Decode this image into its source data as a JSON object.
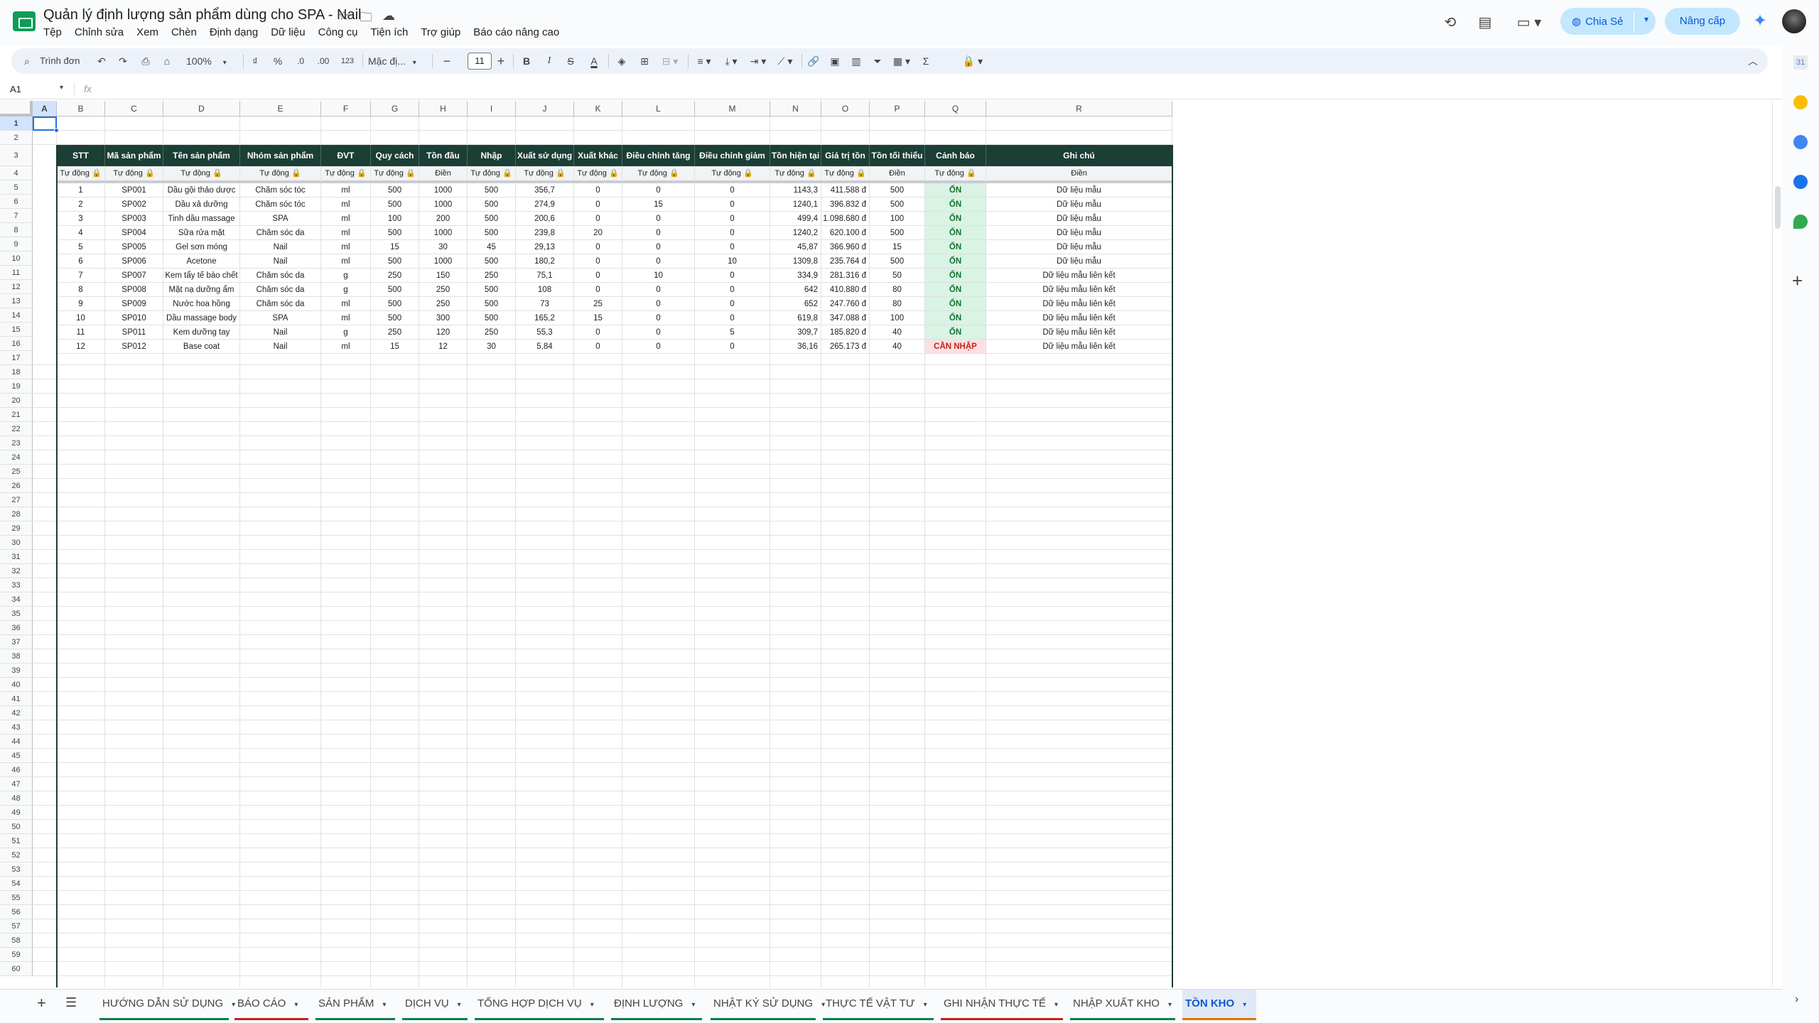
{
  "app": {
    "title": "Quản lý định lượng sản phẩm dùng cho SPA - Nail",
    "menu": [
      "Tệp",
      "Chỉnh sửa",
      "Xem",
      "Chèn",
      "Định dạng",
      "Dữ liệu",
      "Công cụ",
      "Tiện ích",
      "Trợ giúp",
      "Báo cáo nâng cao"
    ],
    "share_label": "Chia Sẻ",
    "upgrade_label": "Nâng cấp"
  },
  "toolbar": {
    "search_label": "Trình đơn",
    "zoom": "100%",
    "currency": "₫",
    "percent": "%",
    "dec_minus": ".0",
    "dec_plus": ".00",
    "num_format": "123",
    "font": "Mặc đị...",
    "font_size": "11",
    "bold": "B",
    "italic": "I",
    "strike": "S",
    "text_color": "A",
    "sum": "Σ"
  },
  "formula_bar": {
    "name_box": "A1",
    "fx": "fx"
  },
  "columns": [
    "A",
    "B",
    "C",
    "D",
    "E",
    "F",
    "G",
    "H",
    "I",
    "J",
    "K",
    "L",
    "M",
    "N",
    "O",
    "P",
    "Q",
    "R"
  ],
  "row_count": 60,
  "table": {
    "headers": [
      "STT",
      "Mã sản phẩm",
      "Tên sản phẩm",
      "Nhóm sản phẩm",
      "ĐVT",
      "Quy cách",
      "Tồn đầu",
      "Nhập",
      "Xuất sử dụng",
      "Xuất khác",
      "Điều chỉnh tăng",
      "Điều chỉnh giảm",
      "Tồn hiện tại",
      "Giá trị tồn",
      "Tồn tối thiểu",
      "Cảnh báo",
      "Ghi chú"
    ],
    "subheaders": [
      "Tự động 🔒",
      "Tự động 🔒",
      "Tự động 🔒",
      "Tự động 🔒",
      "Tự động 🔒",
      "Tự động 🔒",
      "Điền",
      "Tự động 🔒",
      "Tự động 🔒",
      "Tự động 🔒",
      "Tự động 🔒",
      "Tự động 🔒",
      "Tự động 🔒",
      "Tự động 🔒",
      "Điền",
      "Tự động 🔒",
      "Điền"
    ],
    "rows": [
      [
        "1",
        "SP001",
        "Dầu gội thảo dược",
        "Chăm sóc tóc",
        "ml",
        "500",
        "1000",
        "500",
        "356,7",
        "0",
        "0",
        "0",
        "1143,3",
        "411.588 đ",
        "500",
        "ỔN",
        "Dữ liệu mẫu"
      ],
      [
        "2",
        "SP002",
        "Dầu xả dưỡng",
        "Chăm sóc tóc",
        "ml",
        "500",
        "1000",
        "500",
        "274,9",
        "0",
        "15",
        "0",
        "1240,1",
        "396.832 đ",
        "500",
        "ỔN",
        "Dữ liệu mẫu"
      ],
      [
        "3",
        "SP003",
        "Tinh dầu massage",
        "SPA",
        "ml",
        "100",
        "200",
        "500",
        "200,6",
        "0",
        "0",
        "0",
        "499,4",
        "1.098.680 đ",
        "100",
        "ỔN",
        "Dữ liệu mẫu"
      ],
      [
        "4",
        "SP004",
        "Sữa rửa mặt",
        "Chăm sóc da",
        "ml",
        "500",
        "1000",
        "500",
        "239,8",
        "20",
        "0",
        "0",
        "1240,2",
        "620.100 đ",
        "500",
        "ỔN",
        "Dữ liệu mẫu"
      ],
      [
        "5",
        "SP005",
        "Gel sơn móng",
        "Nail",
        "ml",
        "15",
        "30",
        "45",
        "29,13",
        "0",
        "0",
        "0",
        "45,87",
        "366.960 đ",
        "15",
        "ỔN",
        "Dữ liệu mẫu"
      ],
      [
        "6",
        "SP006",
        "Acetone",
        "Nail",
        "ml",
        "500",
        "1000",
        "500",
        "180,2",
        "0",
        "0",
        "10",
        "1309,8",
        "235.764 đ",
        "500",
        "ỔN",
        "Dữ liệu mẫu"
      ],
      [
        "7",
        "SP007",
        "Kem tẩy tế bào chết",
        "Chăm sóc da",
        "g",
        "250",
        "150",
        "250",
        "75,1",
        "0",
        "10",
        "0",
        "334,9",
        "281.316 đ",
        "50",
        "ỔN",
        "Dữ liệu mẫu liên kết"
      ],
      [
        "8",
        "SP008",
        "Mặt nạ dưỡng ẩm",
        "Chăm sóc da",
        "g",
        "500",
        "250",
        "500",
        "108",
        "0",
        "0",
        "0",
        "642",
        "410.880 đ",
        "80",
        "ỔN",
        "Dữ liệu mẫu liên kết"
      ],
      [
        "9",
        "SP009",
        "Nước hoa hồng",
        "Chăm sóc da",
        "ml",
        "500",
        "250",
        "500",
        "73",
        "25",
        "0",
        "0",
        "652",
        "247.760 đ",
        "80",
        "ỔN",
        "Dữ liệu mẫu liên kết"
      ],
      [
        "10",
        "SP010",
        "Dầu massage body",
        "SPA",
        "ml",
        "500",
        "300",
        "500",
        "165,2",
        "15",
        "0",
        "0",
        "619,8",
        "347.088 đ",
        "100",
        "ỔN",
        "Dữ liệu mẫu liên kết"
      ],
      [
        "11",
        "SP011",
        "Kem dưỡng tay",
        "Nail",
        "g",
        "250",
        "120",
        "250",
        "55,3",
        "0",
        "0",
        "5",
        "309,7",
        "185.820 đ",
        "40",
        "ỔN",
        "Dữ liệu mẫu liên kết"
      ],
      [
        "12",
        "SP012",
        "Base coat",
        "Nail",
        "ml",
        "15",
        "12",
        "30",
        "5,84",
        "0",
        "0",
        "0",
        "36,16",
        "265.173 đ",
        "40",
        "CẦN NHẬP",
        "Dữ liệu mẫu liên kết"
      ]
    ]
  },
  "sheets": [
    {
      "name": "HƯỚNG DẪN SỬ DỤNG",
      "color": "#0b8043"
    },
    {
      "name": "BÁO CÁO",
      "color": "#c5221f"
    },
    {
      "name": "SẢN PHẨM",
      "color": "#0b8043"
    },
    {
      "name": "DỊCH VỤ",
      "color": "#0b8043"
    },
    {
      "name": "TỔNG HỢP DỊCH VỤ",
      "color": "#0b8043"
    },
    {
      "name": "ĐỊNH LƯỢNG",
      "color": "#0b8043"
    },
    {
      "name": "NHẬT KÝ SỬ DỤNG",
      "color": "#0b8043"
    },
    {
      "name": "THỰC TẾ VẬT TƯ",
      "color": "#0b8043"
    },
    {
      "name": "GHI NHẬN THỰC TẾ",
      "color": "#c5221f"
    },
    {
      "name": "NHẬP XUẤT KHO",
      "color": "#0b8043"
    },
    {
      "name": "TỒN KHO",
      "color": "#e37400"
    }
  ],
  "active_sheet": "TỒN KHO"
}
